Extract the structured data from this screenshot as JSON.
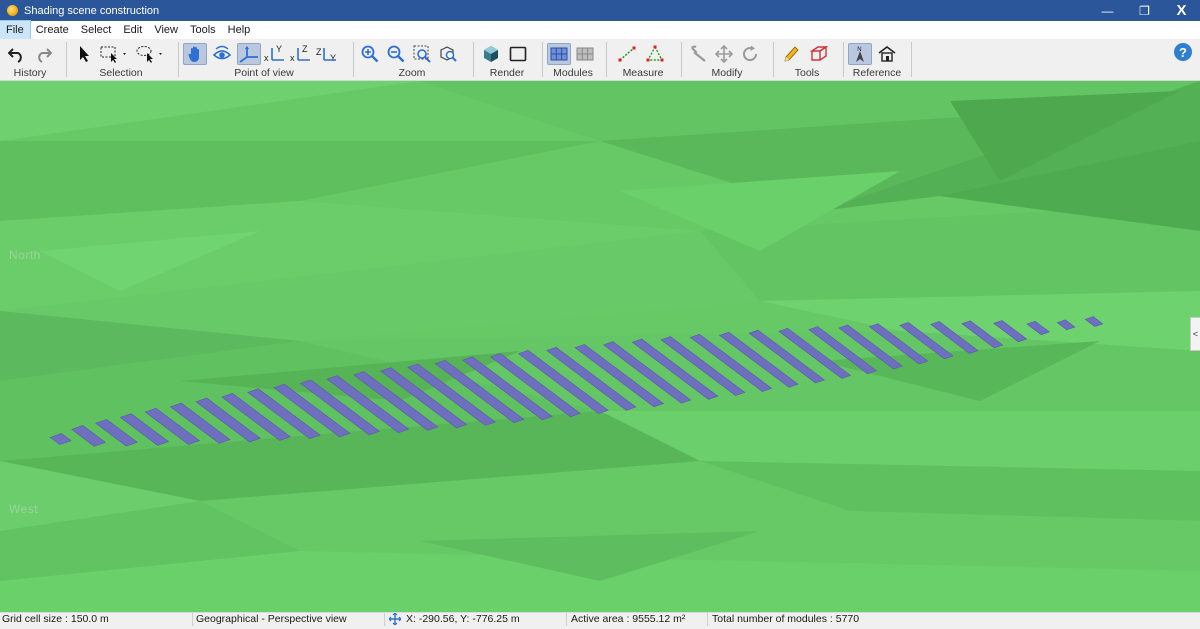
{
  "window": {
    "title": "Shading scene construction",
    "minimize_glyph": "—",
    "restore_glyph": "❐",
    "close_glyph": "X"
  },
  "menu": [
    {
      "label": "File",
      "active": true
    },
    {
      "label": "Create"
    },
    {
      "label": "Select"
    },
    {
      "label": "Edit"
    },
    {
      "label": "View"
    },
    {
      "label": "Tools"
    },
    {
      "label": "Help"
    }
  ],
  "toolbar": {
    "groups": {
      "history": "History",
      "selection": "Selection",
      "point_of_view": "Point of view",
      "zoom": "Zoom",
      "render": "Render",
      "modules": "Modules",
      "measure": "Measure",
      "modify": "Modify",
      "tools": "Tools",
      "reference": "Reference"
    },
    "help_label": "?"
  },
  "viewport": {
    "north_label": "North",
    "west_label": "West",
    "collapse_glyph": "<",
    "terrain_color": "#66c966",
    "module_color": "#6f6fbf"
  },
  "status": {
    "grid": "Grid cell size : 150.0 m",
    "view": "Geographical - Perspective view",
    "coords": "X: -290.56,  Y: -776.25 m",
    "area": "Active area : 9555.12 m²",
    "modules": "Total number of modules : 5770"
  }
}
